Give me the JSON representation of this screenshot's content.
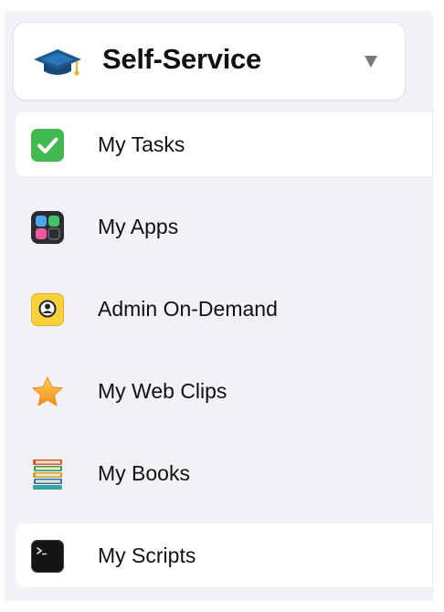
{
  "header": {
    "title": "Self-Service",
    "logo_icon": "graduation-cap-icon",
    "menu_icon": "triangle-down-icon"
  },
  "nav": {
    "items": [
      {
        "label": "My Tasks",
        "icon": "checkmark-icon",
        "selected": true
      },
      {
        "label": "My Apps",
        "icon": "app-grid-icon",
        "selected": false
      },
      {
        "label": "Admin On-Demand",
        "icon": "admin-person-icon",
        "selected": false
      },
      {
        "label": "My Web Clips",
        "icon": "star-icon",
        "selected": false
      },
      {
        "label": "My Books",
        "icon": "books-icon",
        "selected": false
      },
      {
        "label": "My Scripts",
        "icon": "terminal-icon",
        "selected": true
      }
    ]
  },
  "colors": {
    "sidebar_bg": "#f3f0f6",
    "selected_bg": "#ffffff",
    "check_green": "#3fb950",
    "admin_yellow": "#f7d23c",
    "cap_blue": "#1d5a92"
  }
}
